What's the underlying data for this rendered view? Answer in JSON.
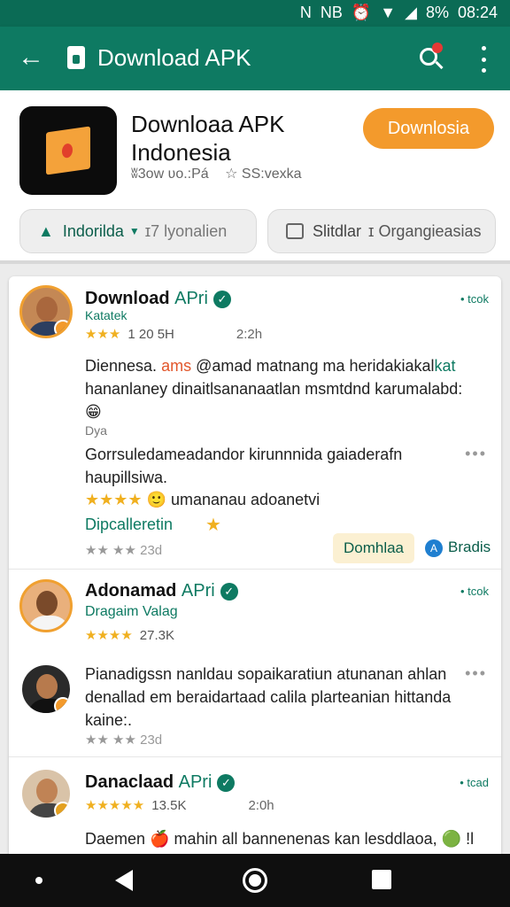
{
  "status": {
    "carrier": "N",
    "nfc": "NB",
    "battery": "8%",
    "time": "08:24"
  },
  "appbar": {
    "title": "Download APK"
  },
  "app": {
    "name": "Downloaa APK Indonesia",
    "meta_left": "ʬ3ow ʋo.:Pá",
    "meta_right": "☆ SS:vexka",
    "download_label": "Downlosia"
  },
  "pills": {
    "region_label": "Indorilda",
    "region_tail": "ɪ7 lyonalien",
    "share_label": "Slitdlar",
    "share_tail": "ɪ Organgieasias"
  },
  "reviews": [
    {
      "name": "Download",
      "brand": "APri",
      "tag": "• tcok",
      "sub": "Katatek",
      "stars": "★★★",
      "count": "1 20 5H",
      "time": "2:2h",
      "text_a": "Diennesa.",
      "text_b": "ams",
      "text_c": "@amad matnang ma heridakiakal",
      "text_d": "kat",
      "text_e": "hananlaney dinaitlsananaatlan msmtdnd karumalabd: 😁",
      "small": "Dya",
      "text2": "Gorrsuledameadandor kirunnnida gaiaderafn haupillsiwa.",
      "dots": "•••",
      "line_stars": "★★★★",
      "line_text": "🙂 umananau adoanetvi",
      "green": "Dipcalleretin",
      "bottom_stars": "★★ ★★ 23d",
      "action1": "Domhlaa",
      "action2": "Bradis"
    },
    {
      "name": "Adonamad",
      "brand": "APri",
      "tag": "• tcok",
      "sub": "Dragaim Valag",
      "stars": "★★★★",
      "count": "27.3K",
      "text": "Pianadigssn nanldau sopaikaratiun atunanan ahlan denallad em beraidartaad calila plarteanian hittanda kaine:.",
      "dots": "•••",
      "bottom_stars": "★★ ★★ 23d"
    },
    {
      "name": "Danaclaad",
      "brand": "APri",
      "tag": "• tcad",
      "stars": "★★★★★",
      "count": "13.5K",
      "time": "2:0h",
      "text": "Daemen 🍎 mahin all bannenenas kan lesddlaoa, 🟢 !l"
    }
  ]
}
